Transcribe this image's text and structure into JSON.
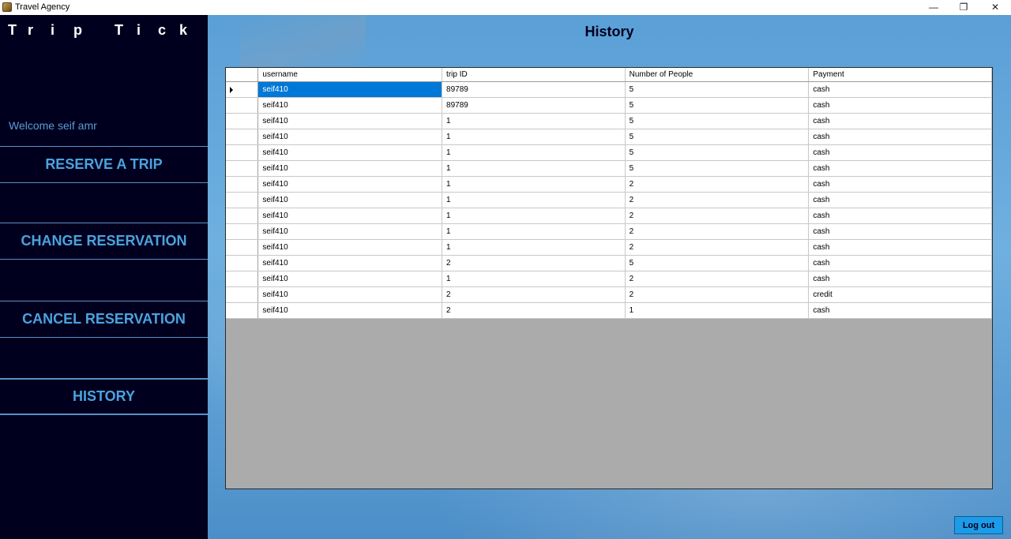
{
  "window": {
    "title": "Travel Agency",
    "minimize_glyph": "—",
    "restore_glyph": "❐",
    "close_glyph": "✕"
  },
  "sidebar": {
    "brand_letters": [
      "T",
      "r",
      "i",
      "p",
      "",
      "T",
      "i",
      "c",
      "k"
    ],
    "welcome": "Welcome seif amr",
    "items": [
      {
        "label": "RESERVE A TRIP"
      },
      {
        "label": "CHANGE RESERVATION"
      },
      {
        "label": "CANCEL RESERVATION"
      },
      {
        "label": "HISTORY"
      }
    ]
  },
  "main": {
    "title": "History",
    "logout_label": "Log out"
  },
  "table": {
    "columns": [
      "username",
      "trip ID",
      "Number of People",
      "Payment"
    ],
    "rows": [
      [
        "seif410",
        "89789",
        "5",
        "cash"
      ],
      [
        "seif410",
        "89789",
        "5",
        "cash"
      ],
      [
        "seif410",
        "1",
        "5",
        "cash"
      ],
      [
        "seif410",
        "1",
        "5",
        "cash"
      ],
      [
        "seif410",
        "1",
        "5",
        "cash"
      ],
      [
        "seif410",
        "1",
        "5",
        "cash"
      ],
      [
        "seif410",
        "1",
        "2",
        "cash"
      ],
      [
        "seif410",
        "1",
        "2",
        "cash"
      ],
      [
        "seif410",
        "1",
        "2",
        "cash"
      ],
      [
        "seif410",
        "1",
        "2",
        "cash"
      ],
      [
        "seif410",
        "1",
        "2",
        "cash"
      ],
      [
        "seif410",
        "2",
        "5",
        "cash"
      ],
      [
        "seif410",
        "1",
        "2",
        "cash"
      ],
      [
        "seif410",
        "2",
        "2",
        "credit"
      ],
      [
        "seif410",
        "2",
        "1",
        "cash"
      ]
    ],
    "selected_row": 0
  },
  "colors": {
    "sidebar_bg": "#00001e",
    "accent": "#4aa3df",
    "selection": "#0078d7"
  }
}
